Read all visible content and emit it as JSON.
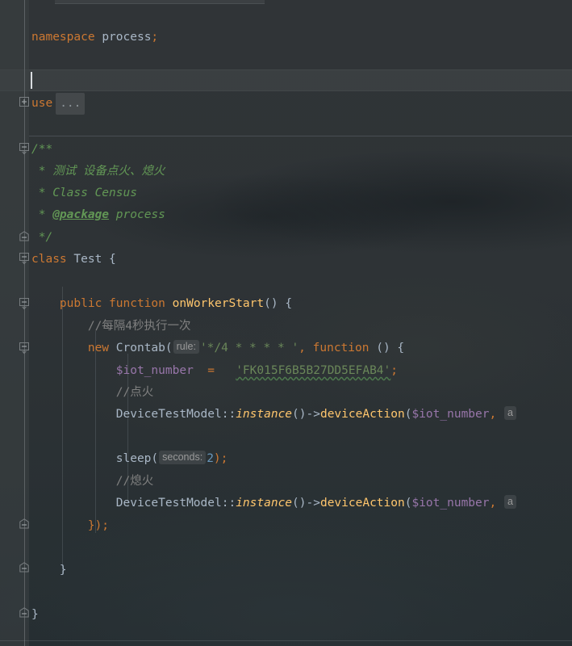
{
  "app": {
    "kind": "code-editor",
    "language": "PHP",
    "theme": "darcula",
    "colors": {
      "background": "#2f3336",
      "foreground": "#a9b7c6",
      "keyword": "#cc7832",
      "string": "#6a8759",
      "number": "#6897bb",
      "comment": "#808080",
      "docblock": "#629755",
      "method": "#ffc66d",
      "variable": "#9876aa",
      "gutter": "#3c4144",
      "current_line": "#3a3f42",
      "caret": "#d9dde0"
    }
  },
  "editor": {
    "caret_line": 3,
    "caret_column": 1,
    "lines": [
      {
        "n": 1,
        "text": "",
        "fold": "none"
      },
      {
        "n": 2,
        "text": "namespace process;",
        "fold": "none"
      },
      {
        "n": 3,
        "text": "",
        "fold": "none"
      },
      {
        "n": 4,
        "text": "",
        "fold": "none",
        "current": true
      },
      {
        "n": 5,
        "text": "use ...",
        "fold": "collapsed"
      },
      {
        "n": 6,
        "text": "",
        "fold": "none"
      },
      {
        "n": 7,
        "text": "/**",
        "fold": "expanded"
      },
      {
        "n": 8,
        "text": " * 测试 设备点火、熄火",
        "fold": "none"
      },
      {
        "n": 9,
        "text": " * Class Census",
        "fold": "none"
      },
      {
        "n": 10,
        "text": " * @package process",
        "fold": "none"
      },
      {
        "n": 11,
        "text": " */",
        "fold": "end"
      },
      {
        "n": 12,
        "text": "class Test {",
        "fold": "expanded"
      },
      {
        "n": 13,
        "text": "",
        "fold": "none"
      },
      {
        "n": 14,
        "text": "    public function onWorkerStart() {",
        "fold": "expanded"
      },
      {
        "n": 15,
        "text": "        //每隔4秒执行一次",
        "fold": "none"
      },
      {
        "n": 16,
        "text": "        new Crontab( rule: '*/4 * * * * ', function () {",
        "fold": "expanded"
      },
      {
        "n": 17,
        "text": "            $iot_number =   'FK015F6B5B27DD5EFAB4';",
        "fold": "none"
      },
      {
        "n": 18,
        "text": "            //点火",
        "fold": "none"
      },
      {
        "n": 19,
        "text": "            DeviceTestModel::instance()->deviceAction($iot_number, a",
        "fold": "none"
      },
      {
        "n": 20,
        "text": "",
        "fold": "none"
      },
      {
        "n": 21,
        "text": "            sleep( seconds: 2);",
        "fold": "none"
      },
      {
        "n": 22,
        "text": "            //熄火",
        "fold": "none"
      },
      {
        "n": 23,
        "text": "            DeviceTestModel::instance()->deviceAction($iot_number, a",
        "fold": "none"
      },
      {
        "n": 24,
        "text": "        });",
        "fold": "end"
      },
      {
        "n": 25,
        "text": "",
        "fold": "none"
      },
      {
        "n": 26,
        "text": "    }",
        "fold": "end"
      },
      {
        "n": 27,
        "text": "",
        "fold": "none"
      },
      {
        "n": 28,
        "text": "}",
        "fold": "end"
      }
    ]
  },
  "tokens": {
    "kw_namespace": "namespace",
    "ns_name": "process",
    "semicolon": ";",
    "kw_use": "use",
    "folded_placeholder": "...",
    "doc_open": "/**",
    "doc_star": "*",
    "doc_line_cn": "测试 设备点火、熄火",
    "doc_line_class": "Class Census",
    "doc_tag_package": "@package",
    "doc_tag_package_value": "process",
    "doc_close": "*/",
    "kw_class": "class",
    "class_name": "Test",
    "brace_open": "{",
    "brace_close": "}",
    "kw_public": "public",
    "kw_function": "function",
    "method_onworkerstart": "onWorkerStart",
    "parens_empty": "()",
    "comment_interval": "//每隔4秒执行一次",
    "kw_new": "new",
    "class_crontab": "Crontab",
    "hint_rule": "rule:",
    "cron_expression": "'*/4 * * * * '",
    "comma": ",",
    "var_iot_number": "$iot_number",
    "assign": "=",
    "iot_value": "'FK015F6B5B27DD5EFAB4'",
    "comment_ignite": "//点火",
    "comment_extinguish": "//熄火",
    "class_devicetestmodel": "DeviceTestModel",
    "scope_operator": "::",
    "method_instance": "instance",
    "arrow": "->",
    "method_deviceaction": "deviceAction",
    "fn_sleep": "sleep",
    "hint_seconds": "seconds:",
    "num_two": "2",
    "close_call": ");",
    "close_closure": "});",
    "truncated_arg": "a"
  },
  "gutter": {
    "markers": [
      {
        "type": "fold-collapsed",
        "line": 5,
        "glyph": "plus-square-icon"
      },
      {
        "type": "fold-expanded",
        "line": 7,
        "glyph": "minus-square-arrow-down-icon"
      },
      {
        "type": "fold-region-end",
        "line": 11,
        "glyph": "minus-square-arrow-up-icon"
      },
      {
        "type": "fold-expanded",
        "line": 12,
        "glyph": "minus-square-arrow-down-icon"
      },
      {
        "type": "fold-expanded",
        "line": 14,
        "glyph": "minus-square-arrow-down-icon"
      },
      {
        "type": "fold-expanded",
        "line": 16,
        "glyph": "minus-square-arrow-down-icon"
      },
      {
        "type": "fold-region-end",
        "line": 24,
        "glyph": "minus-square-arrow-up-icon"
      },
      {
        "type": "fold-region-end",
        "line": 26,
        "glyph": "minus-square-arrow-up-icon"
      },
      {
        "type": "fold-region-end",
        "line": 28,
        "glyph": "minus-square-arrow-up-icon"
      }
    ]
  }
}
